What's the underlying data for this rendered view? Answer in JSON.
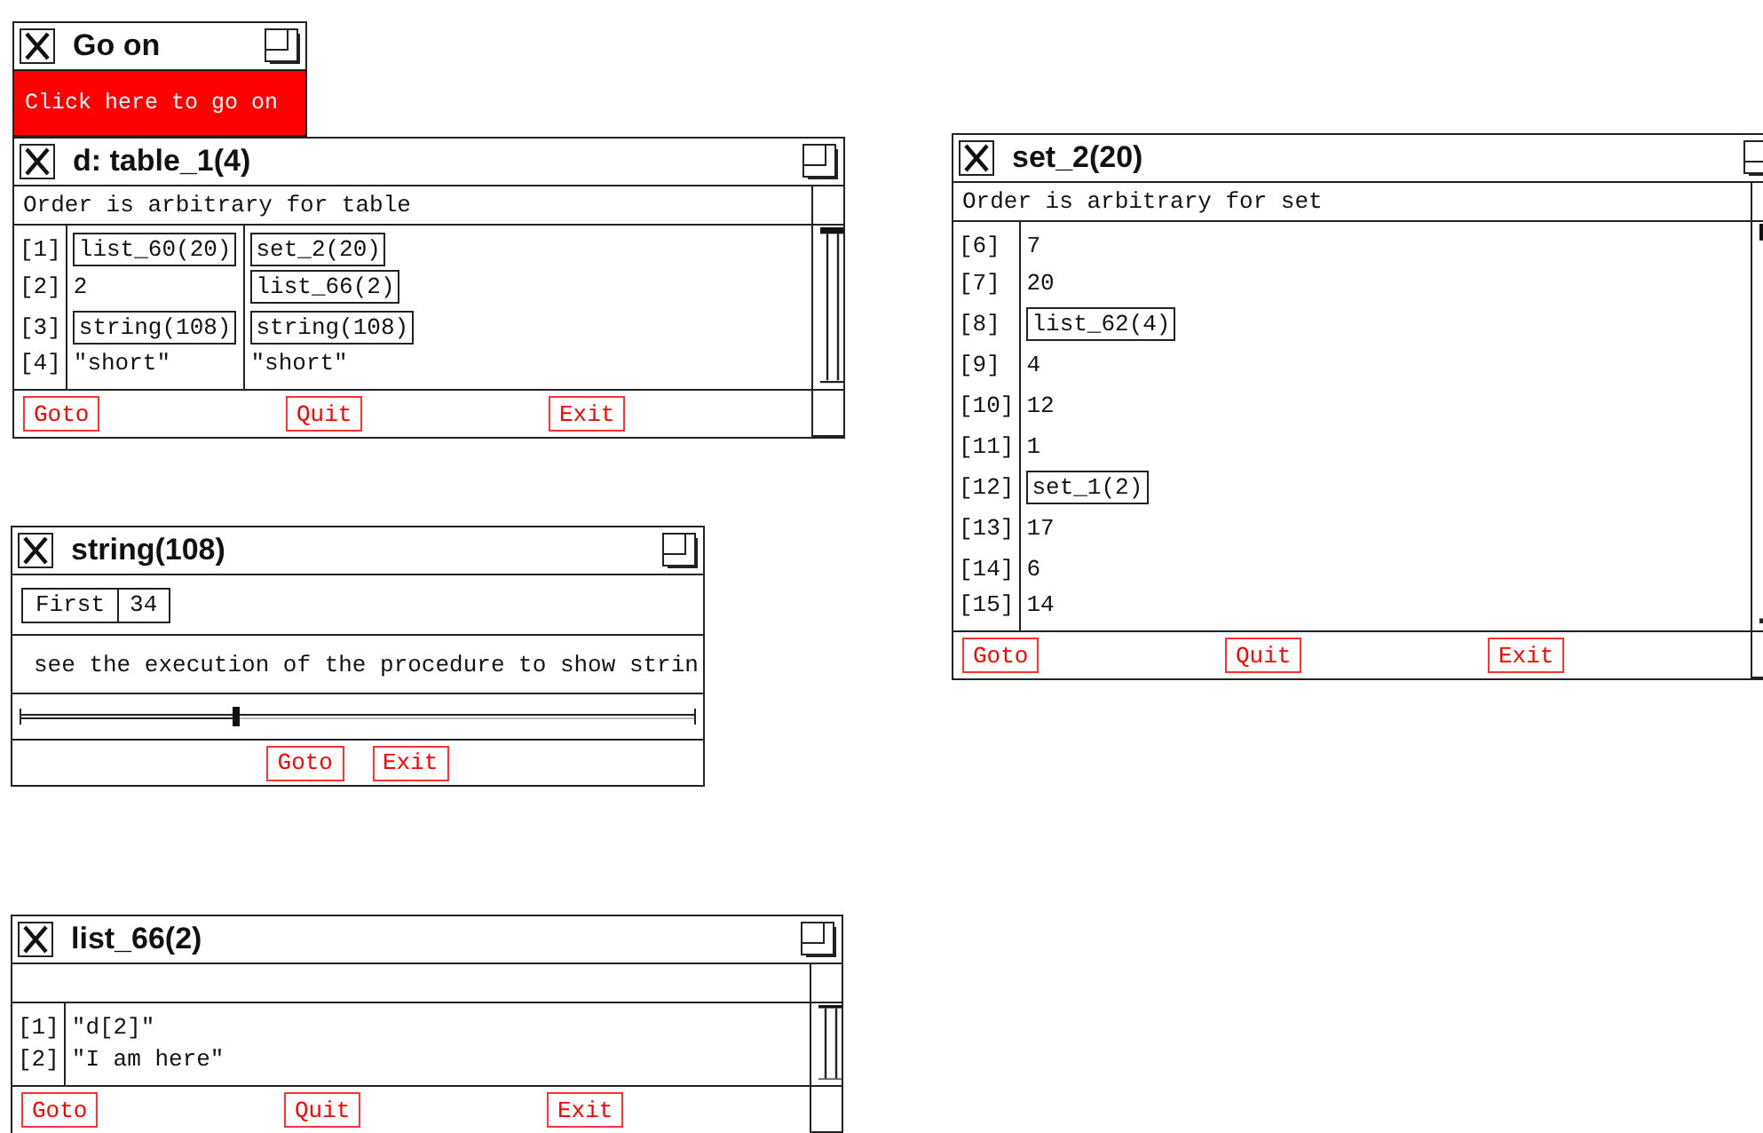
{
  "windows": [
    {
      "kind": "prompt",
      "title": "Go on",
      "button": "Click here to go on"
    },
    {
      "kind": "table",
      "title": "d: table_1(4)",
      "note": "Order is arbitrary for table",
      "rows": [
        {
          "index": "[1]",
          "cells": [
            {
              "kind": "ref",
              "text": "list_60(20)"
            },
            {
              "kind": "ref",
              "text": "set_2(20)"
            }
          ]
        },
        {
          "index": "[2]",
          "cells": [
            {
              "kind": "value",
              "text": "2"
            },
            {
              "kind": "ref",
              "text": "list_66(2)"
            }
          ]
        },
        {
          "index": "[3]",
          "cells": [
            {
              "kind": "ref",
              "text": "string(108)"
            },
            {
              "kind": "ref",
              "text": "string(108)"
            }
          ]
        },
        {
          "index": "[4]",
          "cells": [
            {
              "kind": "value",
              "text": "\"short\""
            },
            {
              "kind": "value",
              "text": "\"short\""
            }
          ]
        }
      ],
      "buttons": [
        "Goto",
        "Quit",
        "Exit"
      ]
    },
    {
      "kind": "table",
      "title": "set_2(20)",
      "note": "Order is arbitrary for set",
      "rows": [
        {
          "index": "[6]",
          "cells": [
            {
              "kind": "value",
              "text": "7"
            }
          ]
        },
        {
          "index": "[7]",
          "cells": [
            {
              "kind": "value",
              "text": "20"
            }
          ]
        },
        {
          "index": "[8]",
          "cells": [
            {
              "kind": "ref",
              "text": "list_62(4)"
            }
          ]
        },
        {
          "index": "[9]",
          "cells": [
            {
              "kind": "value",
              "text": "4"
            }
          ]
        },
        {
          "index": "[10]",
          "cells": [
            {
              "kind": "value",
              "text": "12"
            }
          ]
        },
        {
          "index": "[11]",
          "cells": [
            {
              "kind": "value",
              "text": "1"
            }
          ]
        },
        {
          "index": "[12]",
          "cells": [
            {
              "kind": "ref",
              "text": "set_1(2)"
            }
          ]
        },
        {
          "index": "[13]",
          "cells": [
            {
              "kind": "value",
              "text": "17"
            }
          ]
        },
        {
          "index": "[14]",
          "cells": [
            {
              "kind": "value",
              "text": "6"
            }
          ]
        },
        {
          "index": "[15]",
          "cells": [
            {
              "kind": "value",
              "text": "14"
            }
          ]
        }
      ],
      "buttons": [
        "Goto",
        "Quit",
        "Exit"
      ]
    },
    {
      "kind": "string",
      "title": "string(108)",
      "position": {
        "label": "First",
        "value": "34"
      },
      "text": "see the execution of the procedure to show strin",
      "slider": {
        "level": 0.32
      },
      "buttons": [
        "Goto",
        "Exit"
      ]
    },
    {
      "kind": "table",
      "title": "list_66(2)",
      "rows": [
        {
          "index": "[1]",
          "cells": [
            {
              "kind": "value",
              "text": "\"d[2]\""
            }
          ]
        },
        {
          "index": "[2]",
          "cells": [
            {
              "kind": "value",
              "text": "\"I am here\""
            }
          ]
        }
      ],
      "buttons": [
        "Goto",
        "Quit",
        "Exit"
      ]
    }
  ]
}
